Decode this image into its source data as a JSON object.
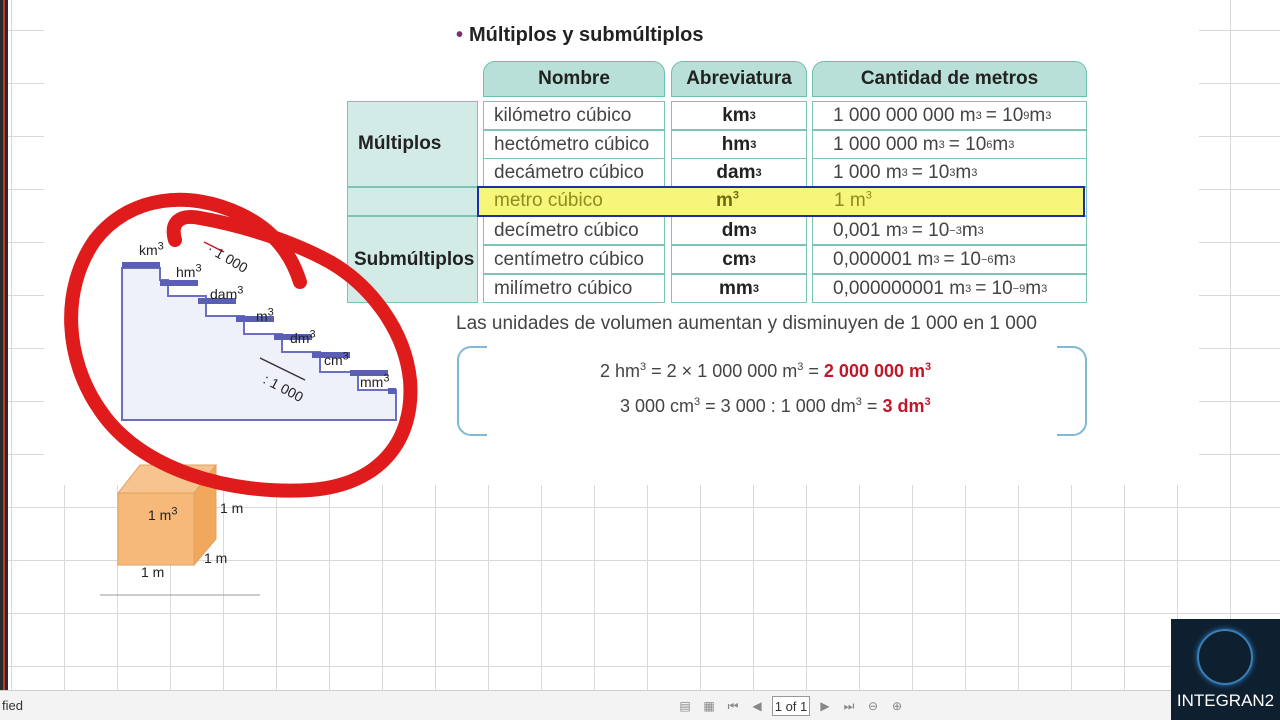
{
  "title": "Múltiplos y submúltiplos",
  "table": {
    "headers": [
      "Nombre",
      "Abreviatura",
      "Cantidad de metros"
    ],
    "group_multiples": "Múltiplos",
    "group_submultiples": "Submúltiplos",
    "rows": [
      {
        "name": "kilómetro cúbico",
        "abbr": "km",
        "qty": "1 000 000 000 m",
        "qty_eq": "= 10",
        "exp": "9",
        "unit": " m"
      },
      {
        "name": "hectómetro cúbico",
        "abbr": "hm",
        "qty": "1 000 000 m",
        "qty_eq": "= 10",
        "exp": "6",
        "unit": " m"
      },
      {
        "name": "decámetro cúbico",
        "abbr": "dam",
        "qty": "1 000 m",
        "qty_eq": "= 10",
        "exp": "3",
        "unit": " m"
      },
      {
        "name": "metro cúbico",
        "abbr": "m",
        "qty": "1 m",
        "qty_eq": "",
        "exp": "",
        "unit": ""
      },
      {
        "name": "decímetro cúbico",
        "abbr": "dm",
        "qty": "0,001 m",
        "qty_eq": "= 10",
        "exp": "−3",
        "unit": " m"
      },
      {
        "name": "centímetro cúbico",
        "abbr": "cm",
        "qty": "0,000001 m",
        "qty_eq": "= 10",
        "exp": "−6",
        "unit": " m"
      },
      {
        "name": "milímetro cúbico",
        "abbr": "mm",
        "qty": "0,000000001 m",
        "qty_eq": "= 10",
        "exp": "−9",
        "unit": " m"
      }
    ]
  },
  "note": "Las unidades de volumen aumentan y disminuyen de 1 000 en 1 000",
  "examples": {
    "line1_left": "2 hm",
    "line1_mid": " = 2 × 1 000 000 m",
    "line1_eq": " = ",
    "line1_result": "2 000 000 m",
    "line2_left": "3 000 cm",
    "line2_mid": " = 3 000 : 1 000 dm",
    "line2_eq": " = ",
    "line2_result": "3 dm"
  },
  "stairs": {
    "labels": [
      "km",
      "hm",
      "dam",
      "m",
      "dm",
      "cm",
      "mm"
    ],
    "up_label": "· 1 000",
    "down_label": ": 1 000"
  },
  "cube": {
    "volume": "1 m",
    "side_top": "1 m",
    "side_right": "1 m",
    "side_bottom": "1 m"
  },
  "status": {
    "text": "fied",
    "page": "1 of 1"
  },
  "logo": {
    "text": "INTEGRAN2"
  },
  "colors": {
    "header_bg": "#b8e0d8",
    "highlight": "#f7f57a",
    "result_red": "#c0182a",
    "annotation_red": "#e01b1b"
  }
}
